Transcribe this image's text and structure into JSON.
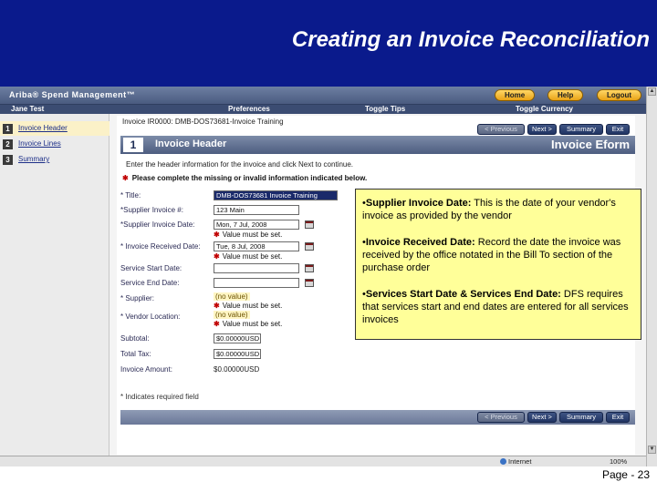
{
  "slide": {
    "title": "Creating an Invoice Reconciliation",
    "page_number": "Page - 23"
  },
  "app": {
    "brand": "Ariba® Spend Management™",
    "nav": {
      "home": "Home",
      "help": "Help",
      "logout": "Logout"
    },
    "user": "Jane Test",
    "subnav": {
      "preferences": "Preferences",
      "toggle_tips": "Toggle Tips",
      "toggle_currency": "Toggle Currency"
    }
  },
  "sidebar": {
    "items": [
      {
        "num": "1",
        "label": "Invoice Header"
      },
      {
        "num": "2",
        "label": "Invoice Lines"
      },
      {
        "num": "3",
        "label": "Summary"
      }
    ]
  },
  "content": {
    "invoice_title": "Invoice IR0000: DMB-DOS73681-Invoice Training",
    "buttons": {
      "previous": "< Previous",
      "next": "Next >",
      "summary": "Summary",
      "exit": "Exit"
    },
    "step_num": "1",
    "step_title": "Invoice Header",
    "eform_title": "Invoice Eform",
    "instructions": "Enter the header information for the invoice and click Next to continue.",
    "error_banner": "Please complete the missing or invalid information indicated below.",
    "fields": {
      "title_label": "* Title:",
      "title_value": "DMB-DOS73681 Invoice Training",
      "supplier_invoice_num_label": "*Supplier Invoice #:",
      "supplier_invoice_num_value": "123 Main",
      "supplier_invoice_date_label": "*Supplier Invoice Date:",
      "supplier_invoice_date_value": "Mon, 7 Jul, 2008",
      "invoice_received_date_label": "* Invoice Received Date:",
      "invoice_received_date_value": "Tue, 8 Jul, 2008",
      "service_start_date_label": "Service Start Date:",
      "service_end_date_label": "Service End Date:",
      "supplier_label": "* Supplier:",
      "supplier_value": "(no value)",
      "vendor_location_label": "* Vendor Location:",
      "vendor_location_value": "(no value)",
      "subtotal_label": "Subtotal:",
      "subtotal_value": "$0.00000USD",
      "total_tax_label": "Total Tax:",
      "total_tax_value": "$0.00000USD",
      "invoice_amount_label": "Invoice Amount:",
      "invoice_amount_value": "$0.00000USD",
      "must_be_set": "Value must be set."
    },
    "footnote": "* Indicates required field"
  },
  "statusbar": {
    "zone": "Internet",
    "zoom": "100%"
  },
  "callout": {
    "items": [
      {
        "bullet": "•",
        "head": "Supplier Invoice Date:",
        "body": "  This is the date of your vendor's invoice as provided by the vendor"
      },
      {
        "bullet": "•",
        "head": "Invoice Received Date:",
        "body": " Record the date the invoice was received by the office notated in the Bill To section of the purchase order"
      },
      {
        "bullet": "•",
        "head": "Services Start Date & Services End Date:",
        "body": " DFS requires that services start and end dates are entered for all services invoices"
      }
    ]
  },
  "colors": {
    "title_band": "#0a1a8c",
    "callout_bg": "#ffff99",
    "nav_button": "#e9a316",
    "header_bar": "#4d5d80"
  }
}
